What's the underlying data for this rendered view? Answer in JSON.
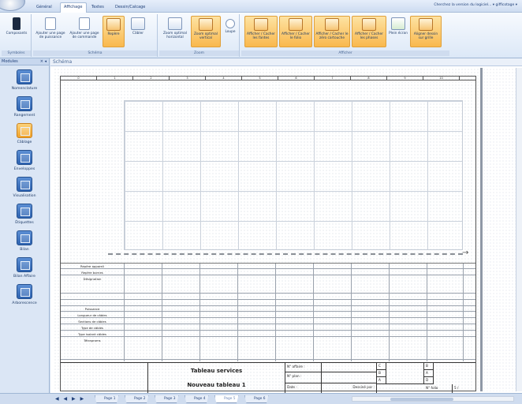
{
  "tabs": [
    "Général",
    "Affichage",
    "Textes",
    "Dessin/Calcage"
  ],
  "active_tab": "Affichage",
  "help_right": "Cherchez la version du logiciel... ▾ gifficotage ▾",
  "ribbon": {
    "groups": [
      {
        "label": "Symboles",
        "buttons": [
          "Composants"
        ]
      },
      {
        "label": "Schéma",
        "buttons": [
          "Ajouter une page de puissance",
          "Ajouter une page de commande",
          "Repère",
          "Câbler"
        ]
      },
      {
        "label": "Zoom",
        "buttons": [
          "Zoom optimal horizontal",
          "Zoom optimal vertical",
          "Loupe"
        ]
      },
      {
        "label": "Afficher",
        "buttons": [
          "Afficher / Cacher les fantes",
          "Afficher / Cacher le folio",
          "Afficher / Cacher le zéro cartouche",
          "Afficher / Cacher les phases",
          "Plein écran",
          "Aligner dessin sur grille"
        ]
      }
    ]
  },
  "left_panel": {
    "title": "Modules",
    "modules": [
      "Nomenclature",
      "Rangement",
      "Câblage",
      "Enveloppes",
      "Visualisation",
      "Étiquettes",
      "Bilan",
      "Bilan Affaire",
      "Arborescence"
    ],
    "selected": "Câblage"
  },
  "document": {
    "title": "Schéma",
    "ruler": [
      "0",
      "1",
      "2",
      "3",
      "4",
      "5",
      "6",
      "7",
      "8",
      "9",
      "10"
    ],
    "properties": [
      "Repère appareil",
      "Repère bornes",
      "Désignation",
      "",
      "",
      "Puissance",
      "Longueur de câbles",
      "Sections de câbles",
      "Type de câbles",
      "Type isolant câbles",
      "Tétraproms"
    ],
    "cartouche": {
      "title1": "Tableau services",
      "title2": "Nouveau tableau 1",
      "affaire_label": "N° affaire :",
      "plan_label": "N° plan :",
      "date_label": "Date :",
      "dessine_label": "Dessiné par :",
      "folio_label": "N° folio",
      "folio_value": "5 /",
      "indices": [
        "C",
        "B",
        "A",
        "D"
      ]
    }
  },
  "status": {
    "nav": "◀ ◀ ▶ ▶",
    "pages": [
      "Page 1",
      "Page 2",
      "Page 3",
      "Page 4",
      "Page 5",
      "Page 6"
    ],
    "active_page": "Page 5"
  }
}
